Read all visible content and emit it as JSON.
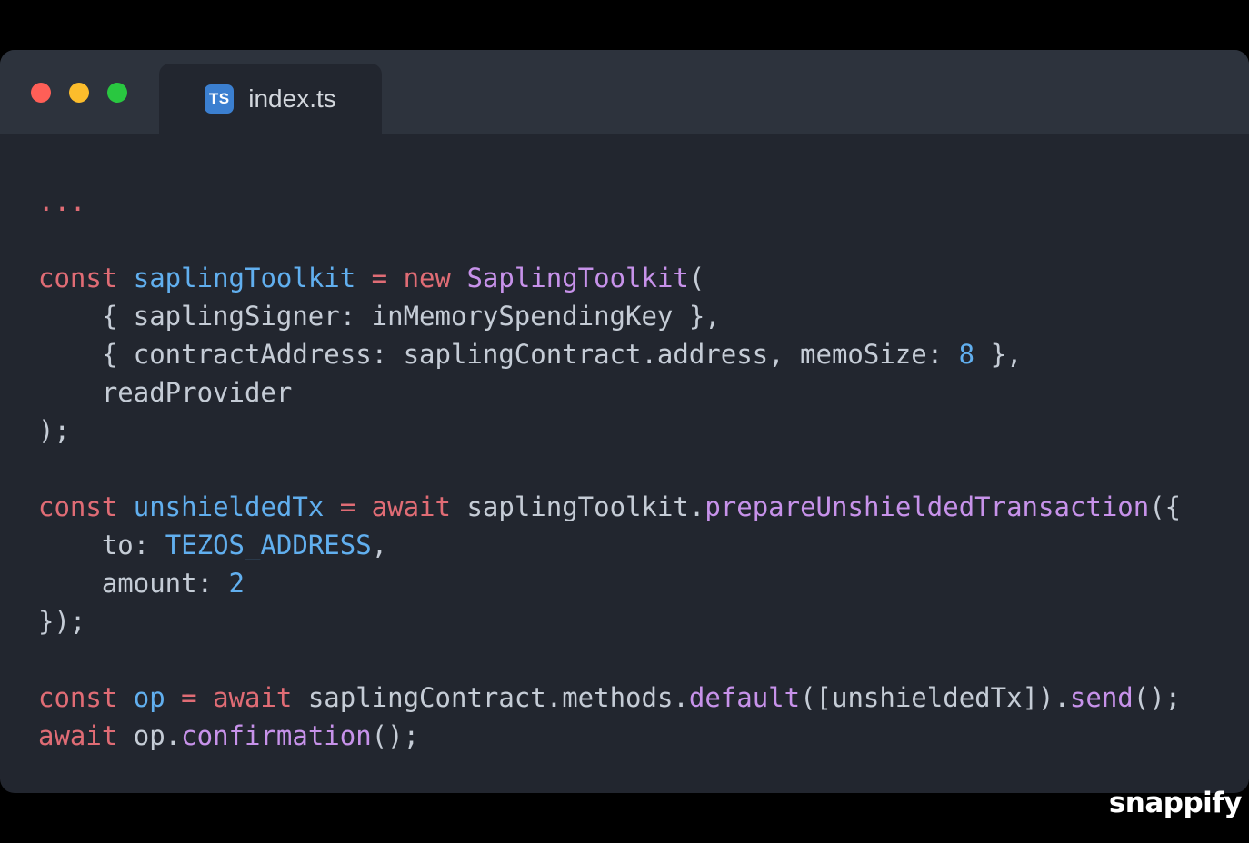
{
  "window": {
    "traffic_lights": [
      {
        "name": "close",
        "color": "#ff5f57"
      },
      {
        "name": "minimize",
        "color": "#fcbd2c"
      },
      {
        "name": "zoom",
        "color": "#29c740"
      }
    ],
    "tab": {
      "icon_text": "TS",
      "icon_color": "#3b7fd0",
      "label": "index.ts"
    }
  },
  "code": {
    "palette": {
      "kw": "#e06c75",
      "var": "#61afef",
      "fn": "#c792ea",
      "plain": "#c5ccd6"
    },
    "lines": [
      {
        "tokens": [
          {
            "c": "kw",
            "t": "..."
          }
        ]
      },
      {
        "tokens": []
      },
      {
        "tokens": [
          {
            "c": "kw",
            "t": "const "
          },
          {
            "c": "var",
            "t": "saplingToolkit "
          },
          {
            "c": "kw",
            "t": "= new "
          },
          {
            "c": "fn",
            "t": "SaplingToolkit"
          },
          {
            "c": "plain",
            "t": "("
          }
        ]
      },
      {
        "tokens": [
          {
            "c": "plain",
            "t": "    { saplingSigner: inMemorySpendingKey },"
          }
        ]
      },
      {
        "tokens": [
          {
            "c": "plain",
            "t": "    { contractAddress: saplingContract.address, memoSize: "
          },
          {
            "c": "var",
            "t": "8"
          },
          {
            "c": "plain",
            "t": " },"
          }
        ]
      },
      {
        "tokens": [
          {
            "c": "plain",
            "t": "    readProvider"
          }
        ]
      },
      {
        "tokens": [
          {
            "c": "plain",
            "t": ");"
          }
        ]
      },
      {
        "tokens": []
      },
      {
        "tokens": [
          {
            "c": "kw",
            "t": "const "
          },
          {
            "c": "var",
            "t": "unshieldedTx "
          },
          {
            "c": "kw",
            "t": "= await "
          },
          {
            "c": "plain",
            "t": "saplingToolkit."
          },
          {
            "c": "fn",
            "t": "prepareUnshieldedTransaction"
          },
          {
            "c": "plain",
            "t": "({"
          }
        ]
      },
      {
        "tokens": [
          {
            "c": "plain",
            "t": "    to: "
          },
          {
            "c": "var",
            "t": "TEZOS_ADDRESS"
          },
          {
            "c": "plain",
            "t": ","
          }
        ]
      },
      {
        "tokens": [
          {
            "c": "plain",
            "t": "    amount: "
          },
          {
            "c": "var",
            "t": "2"
          }
        ]
      },
      {
        "tokens": [
          {
            "c": "plain",
            "t": "});"
          }
        ]
      },
      {
        "tokens": []
      },
      {
        "tokens": [
          {
            "c": "kw",
            "t": "const "
          },
          {
            "c": "var",
            "t": "op "
          },
          {
            "c": "kw",
            "t": "= await "
          },
          {
            "c": "plain",
            "t": "saplingContract.methods."
          },
          {
            "c": "fn",
            "t": "default"
          },
          {
            "c": "plain",
            "t": "([unshieldedTx])."
          },
          {
            "c": "fn",
            "t": "send"
          },
          {
            "c": "plain",
            "t": "();"
          }
        ]
      },
      {
        "tokens": [
          {
            "c": "kw",
            "t": "await "
          },
          {
            "c": "plain",
            "t": "op."
          },
          {
            "c": "fn",
            "t": "confirmation"
          },
          {
            "c": "plain",
            "t": "();"
          }
        ]
      }
    ]
  },
  "watermark": {
    "label": "snappify"
  }
}
